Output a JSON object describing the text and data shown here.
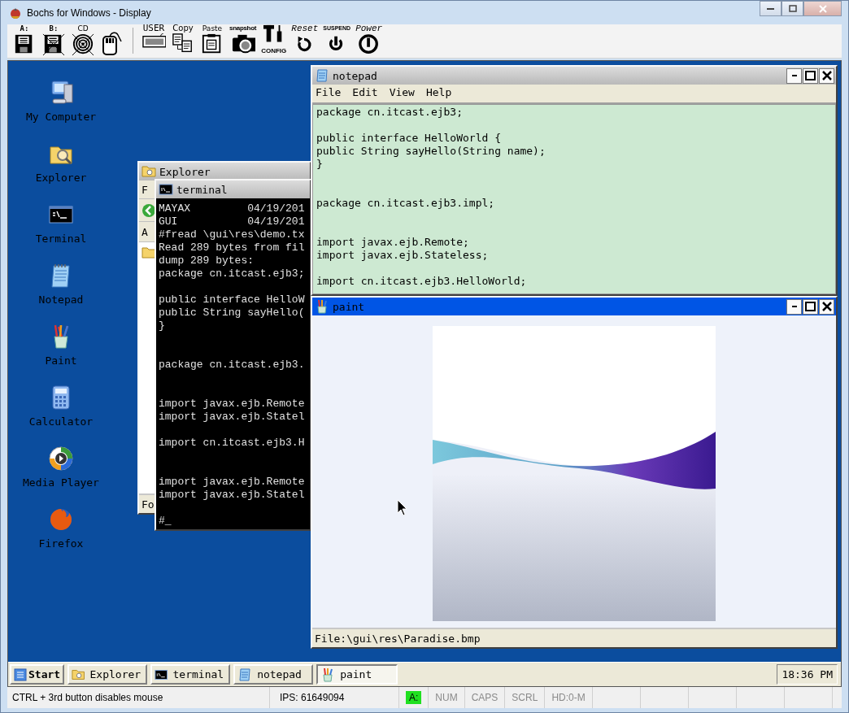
{
  "window": {
    "title": "Bochs for Windows - Display"
  },
  "toolbar": [
    {
      "kind": "floppy",
      "label": "A:",
      "disabled": false
    },
    {
      "kind": "floppy",
      "label": "B:",
      "disabled": true
    },
    {
      "kind": "cdrom",
      "label": "CD",
      "disabled": true
    },
    {
      "kind": "mouse",
      "disabled": false
    },
    {
      "kind": "user",
      "label": "USER"
    },
    {
      "kind": "copy",
      "label": "Copy"
    },
    {
      "kind": "paste",
      "label": "Paste"
    },
    {
      "kind": "snapshot",
      "label": "snapshot"
    },
    {
      "kind": "config",
      "label": "CONFIG"
    },
    {
      "kind": "reset",
      "label": "Reset"
    },
    {
      "kind": "suspend",
      "label": "SUSPEND"
    },
    {
      "kind": "power",
      "label": "Power"
    }
  ],
  "desktop_icons": [
    {
      "kind": "computer",
      "label": "My Computer"
    },
    {
      "kind": "explorer",
      "label": "Explorer"
    },
    {
      "kind": "terminal",
      "label": "Terminal"
    },
    {
      "kind": "notepad",
      "label": "Notepad"
    },
    {
      "kind": "paint",
      "label": "Paint"
    },
    {
      "kind": "calculator",
      "label": "Calculator"
    },
    {
      "kind": "media",
      "label": "Media Player"
    },
    {
      "kind": "firefox",
      "label": "Firefox"
    }
  ],
  "windows": [
    {
      "kind": "explorer",
      "title": "Explorer",
      "active": false,
      "menu": "F",
      "address": "A",
      "status": "Fo"
    },
    {
      "kind": "terminal",
      "title": "terminal",
      "active": false,
      "output": "MAYAX         04/19/201\nGUI           04/19/201\n#fread \\gui\\res\\demo.tx\nRead 289 bytes from fil\ndump 289 bytes:\npackage cn.itcast.ejb3;\n\npublic interface HelloW\npublic String sayHello(\n}\n\n\npackage cn.itcast.ejb3.\n\n\nimport javax.ejb.Remote\nimport javax.ejb.Statel\n\nimport cn.itcast.ejb3.H\n\n\nimport javax.ejb.Remote\nimport javax.ejb.Statel\n\n#_"
    },
    {
      "kind": "notepad",
      "title": "notepad",
      "active": false,
      "menu": [
        "File",
        "Edit",
        "View",
        "Help"
      ],
      "text": "package cn.itcast.ejb3;\n\npublic interface HelloWorld {\npublic String sayHello(String name);\n}\n\n\npackage cn.itcast.ejb3.impl;\n\n\nimport javax.ejb.Remote;\nimport javax.ejb.Stateless;\n\nimport cn.itcast.ejb3.HelloWorld;"
    },
    {
      "kind": "paint",
      "title": "paint",
      "active": true,
      "status": "File:\\gui\\res\\Paradise.bmp"
    }
  ],
  "taskbar": {
    "start": "Start",
    "items": [
      {
        "kind": "explorer",
        "label": "Explorer",
        "selected": false
      },
      {
        "kind": "terminal",
        "label": "terminal",
        "selected": false
      },
      {
        "kind": "notepad",
        "label": "notepad",
        "selected": false
      },
      {
        "kind": "paint",
        "label": "paint",
        "selected": true
      }
    ],
    "clock": "18:36 PM"
  },
  "status_bar": {
    "message": "CTRL + 3rd button disables mouse",
    "ips": "IPS: 61649094",
    "indicators": [
      {
        "label": "A:",
        "on": true
      },
      {
        "label": "NUM",
        "on": false
      },
      {
        "label": "CAPS",
        "on": false
      },
      {
        "label": "SCRL",
        "on": false
      },
      {
        "label": "HD:0-M",
        "on": false
      }
    ]
  }
}
